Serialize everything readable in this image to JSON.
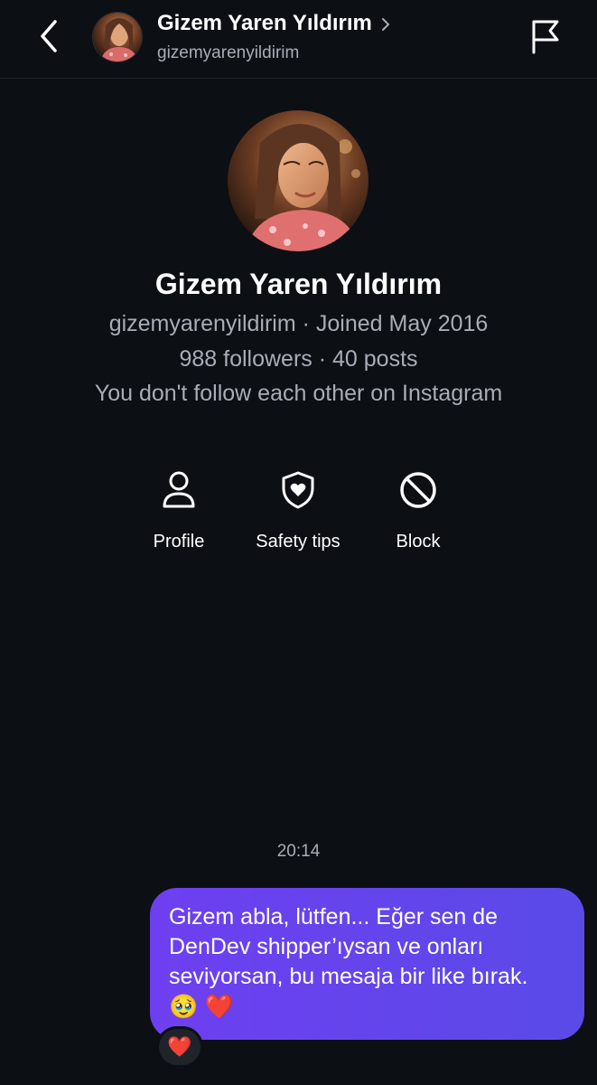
{
  "header": {
    "name": "Gizem Yaren Yıldırım",
    "username": "gizemyarenyildirim",
    "back_icon": "chevron-left-icon",
    "detail_icon": "chevron-right-icon",
    "report_icon": "flag-icon"
  },
  "profile": {
    "name": "Gizem Yaren Yıldırım",
    "username_joined": "gizemyarenyildirim · Joined May 2016",
    "stats": "988 followers · 40 posts",
    "follow_status": "You don't follow each other on Instagram"
  },
  "actions": [
    {
      "label": "Profile",
      "icon": "person-icon"
    },
    {
      "label": "Safety tips",
      "icon": "shield-heart-icon"
    },
    {
      "label": "Block",
      "icon": "block-icon"
    }
  ],
  "conversation": {
    "timestamp": "20:14",
    "messages": [
      {
        "direction": "outgoing",
        "text": "Gizem abla, lütfen... Eğer sen de DenDev shipper’ıysan ve onları seviyorsan, bu mesaja bir like bırak.",
        "emojis": "🥹 ❤️",
        "reaction": "❤️"
      }
    ]
  },
  "colors": {
    "background": "#0c0f14",
    "secondary_text": "#a8adb7",
    "bubble_start": "#6e3ff0",
    "bubble_end": "#5a4ae8"
  }
}
